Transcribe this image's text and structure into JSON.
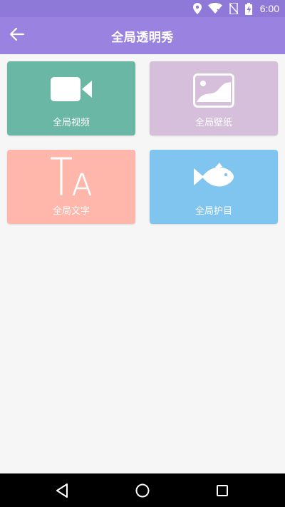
{
  "status_bar": {
    "time": "6:00",
    "icons": [
      "location-icon",
      "wifi-icon",
      "no-sim-icon",
      "battery-charging-icon"
    ]
  },
  "app_bar": {
    "title": "全局透明秀",
    "back_icon": "arrow-left-icon"
  },
  "tiles": [
    {
      "label": "全局视频",
      "icon": "video-camera-icon",
      "color": "#6bb7a6"
    },
    {
      "label": "全局壁纸",
      "icon": "wallpaper-image-icon",
      "color": "#d5bfdb"
    },
    {
      "label": "全局文字",
      "icon": "text-ta-icon",
      "color": "#ffb7ab"
    },
    {
      "label": "全局护目",
      "icon": "fish-icon",
      "color": "#80c4f0"
    }
  ],
  "nav_bar": {
    "icons": [
      "back-triangle-icon",
      "home-circle-icon",
      "recents-square-icon"
    ]
  },
  "colors": {
    "status_bar": "#8e79d8",
    "app_bar": "#9a82e0",
    "background": "#f6f6f6"
  }
}
